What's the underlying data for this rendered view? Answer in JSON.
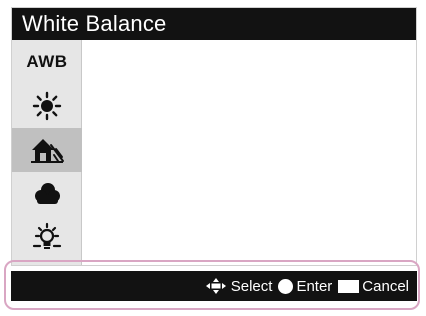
{
  "header": {
    "title": "White Balance"
  },
  "menu": {
    "selected_index": 2,
    "items": [
      {
        "label": "AWB",
        "icon": "awb-icon"
      },
      {
        "icon": "daylight-sun-icon"
      },
      {
        "icon": "shade-house-icon"
      },
      {
        "icon": "cloudy-icon"
      },
      {
        "icon": "incandescent-bulb-icon"
      }
    ]
  },
  "footer": {
    "select_label": "Select",
    "enter_label": "Enter",
    "cancel_label": "Cancel"
  },
  "colors": {
    "bar_background": "#121212",
    "menu_background": "#e6e6e6",
    "selected_item": "#c0c0c0",
    "highlight_frame": "#d9a6c3"
  }
}
